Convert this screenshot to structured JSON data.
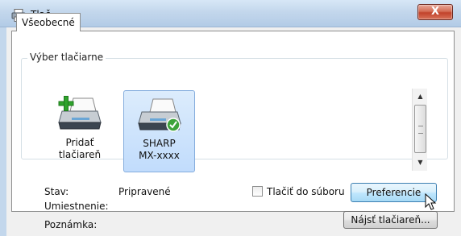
{
  "window": {
    "title": "Tlač",
    "close_label": "X"
  },
  "tabs": [
    {
      "label": "Všeobecné"
    }
  ],
  "printer_group": {
    "legend": "Výber tlačiarne",
    "printers": [
      {
        "name_line1": "Pridať",
        "name_line2": "tlačiareň",
        "icon": "add-printer-icon",
        "selected": false
      },
      {
        "name_line1": "SHARP",
        "name_line2": "MX-xxxx",
        "icon": "printer-default-icon",
        "selected": true
      }
    ]
  },
  "info": {
    "status_label": "Stav:",
    "status_value": "Pripravené",
    "location_label": "Umiestnenie:",
    "note_label": "Poznámka:"
  },
  "options": {
    "print_to_file_label": "Tlačiť do súboru",
    "print_to_file_checked": false
  },
  "buttons": {
    "preferences": "Preferencie",
    "find_printer": "Nájsť tlačiareň..."
  },
  "colors": {
    "selection_fill": "#c1dcfc",
    "selection_border": "#84acdd",
    "titlebar": "#c3d7ec",
    "close_button": "#c1432a"
  }
}
